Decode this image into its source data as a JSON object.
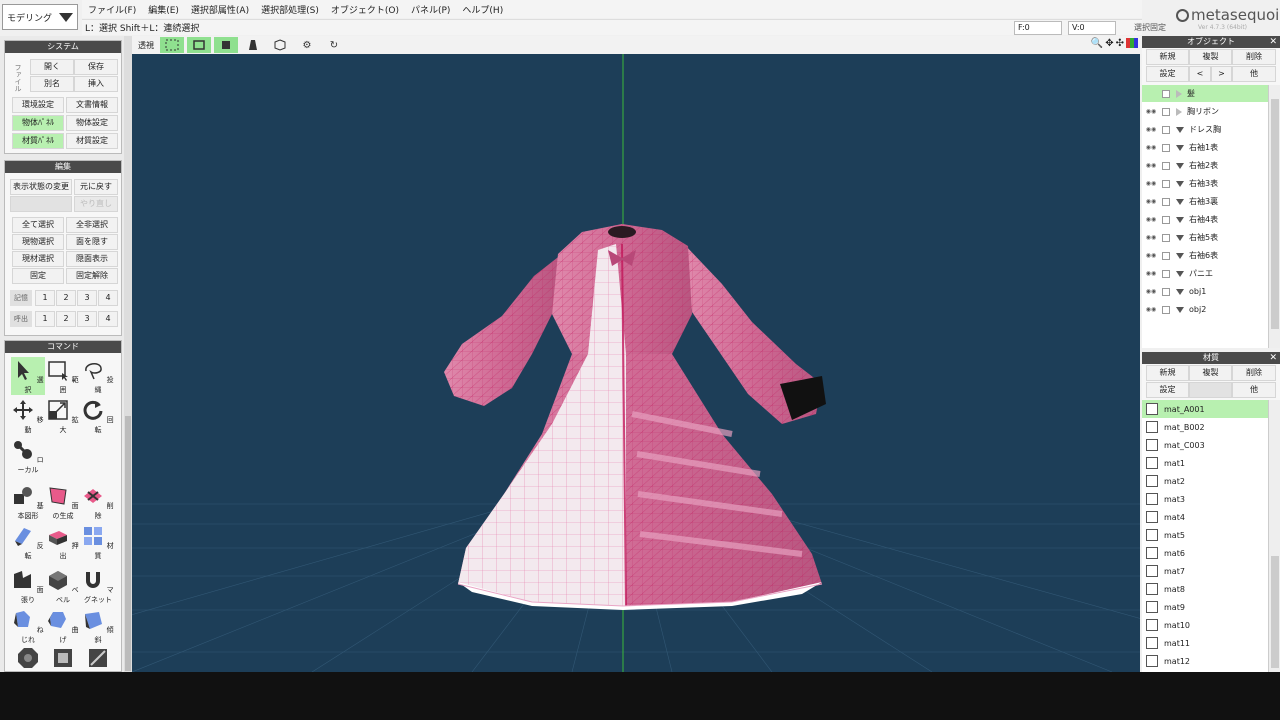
{
  "app": {
    "mode_label": "モデリング",
    "menu": [
      "ファイル(F)",
      "編集(E)",
      "選択部属性(A)",
      "選択部処理(S)",
      "オブジェクト(O)",
      "パネル(P)",
      "ヘルプ(H)"
    ],
    "hint": "L：選択  Shift＋L：連続選択",
    "face_count": "F:0",
    "vertex_count": "V:0",
    "selection_fixed": "選択固定",
    "logo": "metasequoia",
    "logo_version_number": "4",
    "logo_subtext": "Ver 4.7.3 (64bit)"
  },
  "system_panel": {
    "title": "システム",
    "side_label": "ファイル",
    "open": "開く",
    "save": "保存",
    "save_as": "別名",
    "insert": "挿入",
    "env_settings": "環境設定",
    "doc_info": "文書情報",
    "object_panel": "物体ﾊﾟﾈﾙ",
    "object_settings": "物体設定",
    "material_panel": "材質ﾊﾟﾈﾙ",
    "material_settings": "材質設定"
  },
  "edit_panel": {
    "title": "編集",
    "change_display": "表示状態の変更",
    "undo": "元に戻す",
    "redo": "やり直し",
    "select_all": "全て選択",
    "deselect_all": "全非選択",
    "select_current": "現物選択",
    "hide_faces": "面を隠す",
    "select_material": "現材選択",
    "show_hidden": "隠面表示",
    "lock": "固定",
    "unlock": "固定解除",
    "memory_label": "記憶",
    "recall_label": "呼出",
    "slots": [
      "1",
      "2",
      "3",
      "4"
    ]
  },
  "command_panel": {
    "title": "コマンド",
    "tools": [
      {
        "label": "選択",
        "key": "S"
      },
      {
        "label": "範囲",
        "key": "R"
      },
      {
        "label": "投縄",
        "key": "C"
      },
      {
        "label": "移動",
        "key": "M"
      },
      {
        "label": "拡大",
        "key": "S"
      },
      {
        "label": "回転",
        "key": "R"
      },
      {
        "label": "ローカル",
        "key": "L"
      },
      {
        "label": "基本図形",
        "key": ""
      },
      {
        "label": "面の生成",
        "key": "F"
      },
      {
        "label": "削除",
        "key": "D"
      },
      {
        "label": "反転",
        "key": ""
      },
      {
        "label": "押出",
        "key": "E"
      },
      {
        "label": "材質",
        "key": "M"
      },
      {
        "label": "面張り",
        "key": "H"
      },
      {
        "label": "ベベル",
        "key": ""
      },
      {
        "label": "マグネット",
        "key": "B"
      },
      {
        "label": "ねじれ",
        "key": ""
      },
      {
        "label": "曲げ",
        "key": ""
      },
      {
        "label": "傾斜",
        "key": ""
      }
    ]
  },
  "viewport": {
    "view_label": "透視"
  },
  "object_panel": {
    "title": "オブジェクト",
    "new": "新規",
    "duplicate": "複製",
    "delete": "削除",
    "settings": "設定",
    "prev": "<",
    "next": ">",
    "other": "他",
    "items": [
      "髪",
      "胸リボン",
      "ドレス胸",
      "右袖1表",
      "右袖2表",
      "右袖3表",
      "右袖3裏",
      "右袖4表",
      "右袖5表",
      "右袖6表",
      "パニエ",
      "obj1",
      "obj2"
    ]
  },
  "material_panel": {
    "title": "材質",
    "new": "新規",
    "duplicate": "複製",
    "delete": "削除",
    "settings": "設定",
    "other": "他",
    "items": [
      "mat_A001",
      "mat_B002",
      "mat_C003",
      "mat1",
      "mat2",
      "mat3",
      "mat4",
      "mat5",
      "mat6",
      "mat7",
      "mat8",
      "mat9",
      "mat10",
      "mat11",
      "mat12"
    ]
  },
  "colors": {
    "viewport_bg": "#1d3e58",
    "selected_green": "#b8f0b0",
    "dress_pink": "#d9739c",
    "dress_white": "#f3e9ee",
    "y_axis": "#3ab83a"
  }
}
